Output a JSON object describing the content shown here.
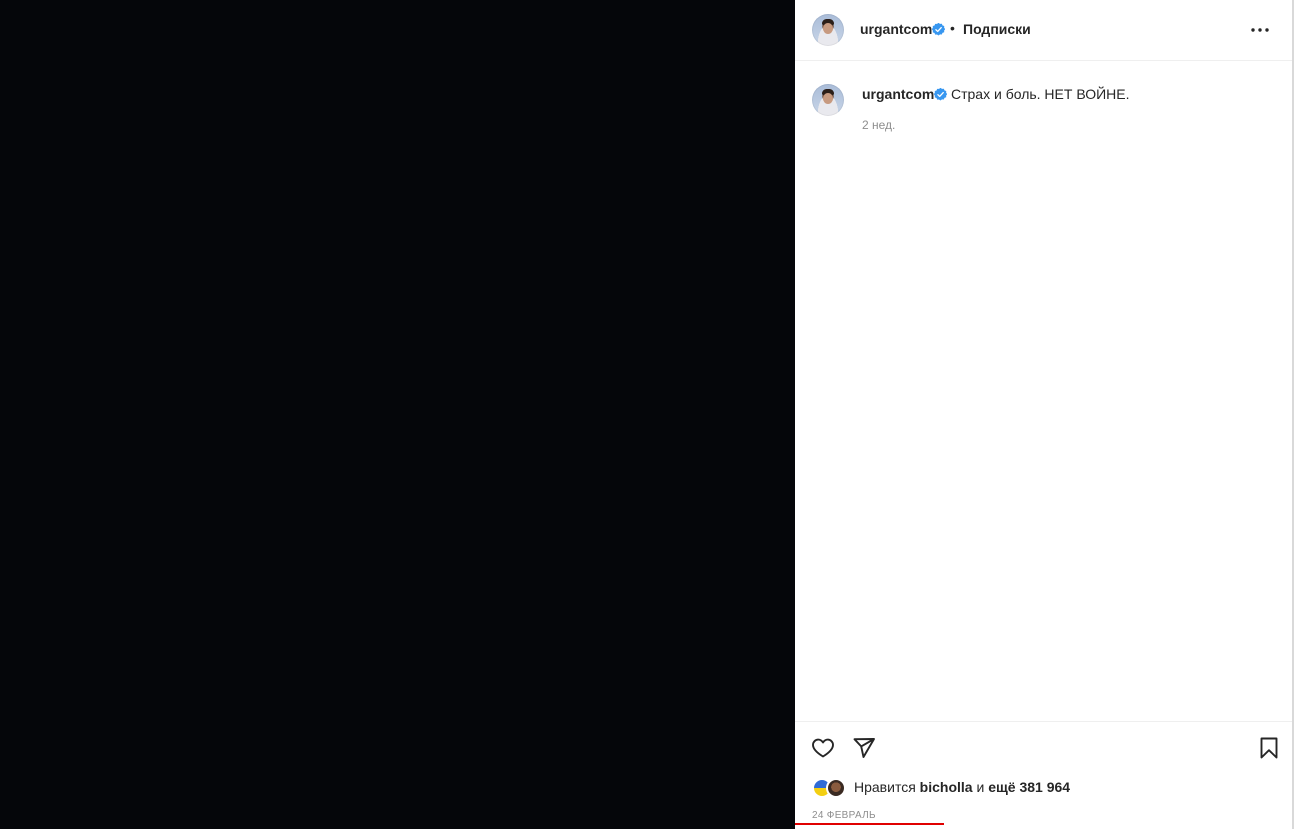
{
  "header": {
    "username": "urgantcom",
    "separator": "•",
    "follow_label": "Подписки"
  },
  "caption": {
    "username": "urgantcom",
    "text": "Страх и боль. НЕТ ВОЙНЕ.",
    "time_ago": "2 нед."
  },
  "footer": {
    "likes_prefix": "Нравится",
    "liked_by": "bicholla",
    "likes_and": "и",
    "likes_others": "ещё 381 964",
    "date": "24 ФЕВРАЛЬ"
  },
  "icons": {
    "verified": "verified-badge-icon",
    "more": "more-options-icon",
    "like": "heart-icon",
    "share": "paper-plane-icon",
    "save": "bookmark-icon"
  },
  "colors": {
    "media_background": "#05060a",
    "verified": "#3897f0",
    "text": "#262626",
    "secondary_text": "#8e8e8e",
    "annotation_underline": "#e00000"
  }
}
